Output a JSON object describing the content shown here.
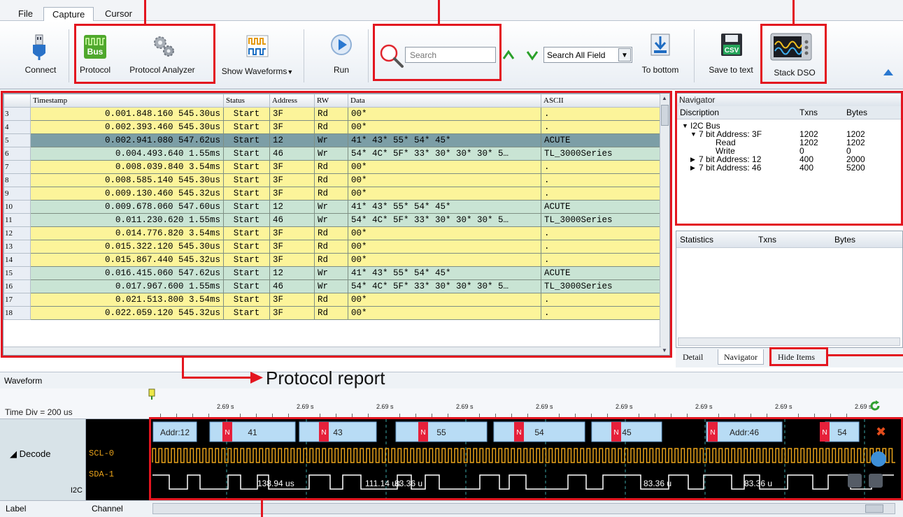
{
  "menu": {
    "tabs": [
      "File",
      "Capture",
      "Cursor"
    ],
    "active": "Capture"
  },
  "toolbar": {
    "connect": "Connect",
    "protocol": "Protocol",
    "protocol_analyzer": "Protocol Analyzer",
    "show_waveforms": "Show Waveforms",
    "run": "Run",
    "search_placeholder": "Search",
    "search_field": "Search All Field",
    "to_bottom": "To bottom",
    "save_to_text": "Save to text",
    "stack_dso": "Stack DSO",
    "bus_icon_text": "Bus",
    "csv_icon_text": "CSV"
  },
  "protocol_table": {
    "columns": [
      "Timestamp",
      "Status",
      "Address",
      "RW",
      "Data",
      "ASCII"
    ],
    "rows": [
      {
        "num": "3",
        "timestamp": "0.001.848.160 545.30us",
        "status": "Start",
        "address": "3F",
        "rw": "Rd",
        "data": "00*",
        "ascii": "."
      },
      {
        "num": "4",
        "timestamp": "0.002.393.460 545.30us",
        "status": "Start",
        "address": "3F",
        "rw": "Rd",
        "data": "00*",
        "ascii": "."
      },
      {
        "num": "5",
        "timestamp": "0.002.941.080 547.62us",
        "status": "Start",
        "address": "12",
        "rw": "Wr",
        "data": "41* 43* 55* 54* 45*",
        "ascii": "ACUTE"
      },
      {
        "num": "6",
        "timestamp": "0.004.493.640 1.55ms",
        "status": "Start",
        "address": "46",
        "rw": "Wr",
        "data": "54* 4C* 5F* 33* 30* 30* 30* 5…",
        "ascii": "TL_3000Series"
      },
      {
        "num": "7",
        "timestamp": "0.008.039.840 3.54ms",
        "status": "Start",
        "address": "3F",
        "rw": "Rd",
        "data": "00*",
        "ascii": "."
      },
      {
        "num": "8",
        "timestamp": "0.008.585.140 545.30us",
        "status": "Start",
        "address": "3F",
        "rw": "Rd",
        "data": "00*",
        "ascii": "."
      },
      {
        "num": "9",
        "timestamp": "0.009.130.460 545.32us",
        "status": "Start",
        "address": "3F",
        "rw": "Rd",
        "data": "00*",
        "ascii": "."
      },
      {
        "num": "10",
        "timestamp": "0.009.678.060 547.60us",
        "status": "Start",
        "address": "12",
        "rw": "Wr",
        "data": "41* 43* 55* 54* 45*",
        "ascii": "ACUTE"
      },
      {
        "num": "11",
        "timestamp": "0.011.230.620 1.55ms",
        "status": "Start",
        "address": "46",
        "rw": "Wr",
        "data": "54* 4C* 5F* 33* 30* 30* 30* 5…",
        "ascii": "TL_3000Series"
      },
      {
        "num": "12",
        "timestamp": "0.014.776.820 3.54ms",
        "status": "Start",
        "address": "3F",
        "rw": "Rd",
        "data": "00*",
        "ascii": "."
      },
      {
        "num": "13",
        "timestamp": "0.015.322.120 545.30us",
        "status": "Start",
        "address": "3F",
        "rw": "Rd",
        "data": "00*",
        "ascii": "."
      },
      {
        "num": "14",
        "timestamp": "0.015.867.440 545.32us",
        "status": "Start",
        "address": "3F",
        "rw": "Rd",
        "data": "00*",
        "ascii": "."
      },
      {
        "num": "15",
        "timestamp": "0.016.415.060 547.62us",
        "status": "Start",
        "address": "12",
        "rw": "Wr",
        "data": "41* 43* 55* 54* 45*",
        "ascii": "ACUTE"
      },
      {
        "num": "16",
        "timestamp": "0.017.967.600 1.55ms",
        "status": "Start",
        "address": "46",
        "rw": "Wr",
        "data": "54* 4C* 5F* 33* 30* 30* 30* 5…",
        "ascii": "TL_3000Series"
      },
      {
        "num": "17",
        "timestamp": "0.021.513.800 3.54ms",
        "status": "Start",
        "address": "3F",
        "rw": "Rd",
        "data": "00*",
        "ascii": "."
      },
      {
        "num": "18",
        "timestamp": "0.022.059.120 545.32us",
        "status": "Start",
        "address": "3F",
        "rw": "Rd",
        "data": "00*",
        "ascii": "."
      }
    ],
    "selected_row": "5"
  },
  "navigator": {
    "title": "Navigator",
    "headers": {
      "description": "Discription",
      "txns": "Txns",
      "bytes": "Bytes"
    },
    "tree": [
      {
        "label": "I2C Bus",
        "txns": "",
        "bytes": "",
        "level": 0,
        "arrow": "▼"
      },
      {
        "label": "7 bit Address: 3F",
        "txns": "1202",
        "bytes": "1202",
        "level": 1,
        "arrow": "▼"
      },
      {
        "label": "Read",
        "txns": "1202",
        "bytes": "1202",
        "level": 2,
        "arrow": ""
      },
      {
        "label": "Write",
        "txns": "0",
        "bytes": "0",
        "level": 2,
        "arrow": ""
      },
      {
        "label": "7 bit Address: 12",
        "txns": "400",
        "bytes": "2000",
        "level": 1,
        "arrow": "▶"
      },
      {
        "label": "7 bit Address: 46",
        "txns": "400",
        "bytes": "5200",
        "level": 1,
        "arrow": "▶"
      }
    ]
  },
  "statistics": {
    "headers": {
      "statistics": "Statistics",
      "txns": "Txns",
      "bytes": "Bytes"
    }
  },
  "nav_tabs": {
    "detail": "Detail",
    "navigator": "Navigator",
    "hide_items": "Hide Items"
  },
  "waveform": {
    "title": "Waveform",
    "time_div": "Time Div = 200 us",
    "tick_label": "2.69 s",
    "decode_label": "Decode",
    "protocol": "I2C",
    "channels": [
      "SCL-0",
      "SDA-1"
    ],
    "segments": [
      {
        "text": "Addr:12"
      },
      {
        "text": "41"
      },
      {
        "text": "43"
      },
      {
        "text": "55"
      },
      {
        "text": "54"
      },
      {
        "text": "45"
      },
      {
        "text": "Addr:46"
      },
      {
        "text": "54"
      }
    ],
    "nack": "N",
    "measurements": [
      "138.94 us",
      "111.14 us",
      "83.36 u",
      "83.36 u",
      "83.36 u"
    ]
  },
  "bottom": {
    "label": "Label",
    "channel": "Channel"
  },
  "annotation": {
    "protocol_report": "Protocol report"
  },
  "colors": {
    "annotation_red": "#e3151f",
    "read_row": "#fcf49a",
    "write_row": "#c9e4d4",
    "selected_row": "#7c9ea6",
    "scl_trace": "#e8a21a",
    "sda_trace": "#ffffff",
    "segment_fill": "#b8dcf5",
    "nack_fill": "#e6203a"
  }
}
